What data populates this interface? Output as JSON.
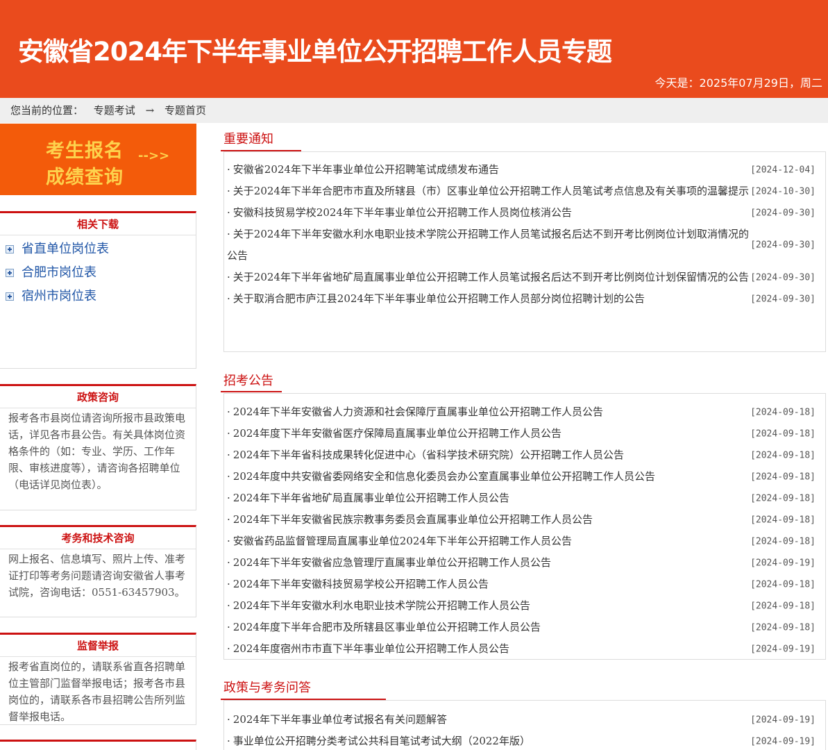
{
  "header": {
    "title": "安徽省2024年下半年事业单位公开招聘工作人员专题",
    "date_text": "今天是：2025年07月29日，周二"
  },
  "breadcrumb": {
    "label": "您当前的位置：",
    "items": [
      "专题考试",
      "→",
      "专题首页"
    ]
  },
  "signup_banner": {
    "line1": "考生报名",
    "line2": "成绩查询",
    "arrow": "-->>"
  },
  "downloads": {
    "title": "相关下载",
    "items": [
      {
        "label": "省直单位岗位表"
      },
      {
        "label": "合肥市岗位表"
      },
      {
        "label": "宿州市岗位表"
      }
    ]
  },
  "policy": {
    "title": "政策咨询",
    "text": "报考各市县岗位请咨询所报市县政策电话，详见各市县公告。有关具体岗位资格条件的（如：专业、学历、工作年限、审核进度等），请咨询各招聘单位（电话详见岗位表）。"
  },
  "tech": {
    "title": "考务和技术咨询",
    "text": "网上报名、信息填写、照片上传、准考证打印等考务问题请咨询安徽省人事考试院，咨询电话：0551-63457903。"
  },
  "report": {
    "title": "监督举报",
    "text": "报考省直岗位的，请联系省直各招聘单位主管部门监督举报电话；报考各市县岗位的，请联系各市县招聘公告所列监督举报电话。"
  },
  "notices": {
    "title": "重要通知",
    "items": [
      {
        "title": "安徽省2024年下半年事业单位公开招聘笔试成绩发布通告",
        "date": "[2024-12-04]"
      },
      {
        "title": "关于2024年下半年合肥市市直及所辖县（市）区事业单位公开招聘工作人员笔试考点信息及有关事项的温馨提示",
        "date": "[2024-10-30]"
      },
      {
        "title": "安徽科技贸易学校2024年下半年事业单位公开招聘工作人员岗位核消公告",
        "date": "[2024-09-30]"
      },
      {
        "title": "关于2024年下半年安徽水利水电职业技术学院公开招聘工作人员笔试报名后达不到开考比例岗位计划取消情况的公告",
        "date": "[2024-09-30]"
      },
      {
        "title": "关于2024年下半年省地矿局直属事业单位公开招聘工作人员笔试报名后达不到开考比例岗位计划保留情况的公告",
        "date": "[2024-09-30]"
      },
      {
        "title": "关于取消合肥市庐江县2024年下半年事业单位公开招聘工作人员部分岗位招聘计划的公告",
        "date": "[2024-09-30]"
      }
    ]
  },
  "announcements": {
    "title": "招考公告",
    "items": [
      {
        "title": "2024年下半年安徽省人力资源和社会保障厅直属事业单位公开招聘工作人员公告",
        "date": "[2024-09-18]"
      },
      {
        "title": "2024年度下半年安徽省医疗保障局直属事业单位公开招聘工作人员公告",
        "date": "[2024-09-18]"
      },
      {
        "title": "2024年下半年省科技成果转化促进中心（省科学技术研究院）公开招聘工作人员公告",
        "date": "[2024-09-18]"
      },
      {
        "title": "2024年度中共安徽省委网络安全和信息化委员会办公室直属事业单位公开招聘工作人员公告",
        "date": "[2024-09-18]"
      },
      {
        "title": "2024年下半年省地矿局直属事业单位公开招聘工作人员公告",
        "date": "[2024-09-18]"
      },
      {
        "title": "2024年下半年安徽省民族宗教事务委员会直属事业单位公开招聘工作人员公告",
        "date": "[2024-09-18]"
      },
      {
        "title": "安徽省药品监督管理局直属事业单位2024年下半年公开招聘工作人员公告",
        "date": "[2024-09-18]"
      },
      {
        "title": "2024年下半年安徽省应急管理厅直属事业单位公开招聘工作人员公告",
        "date": "[2024-09-19]"
      },
      {
        "title": "2024年下半年安徽科技贸易学校公开招聘工作人员公告",
        "date": "[2024-09-18]"
      },
      {
        "title": "2024年下半年安徽水利水电职业技术学院公开招聘工作人员公告",
        "date": "[2024-09-18]"
      },
      {
        "title": "2024年度下半年合肥市及所辖县区事业单位公开招聘工作人员公告",
        "date": "[2024-09-18]"
      },
      {
        "title": "2024年度宿州市市直下半年事业单位公开招聘工作人员公告",
        "date": "[2024-09-19]"
      }
    ]
  },
  "faq": {
    "title": "政策与考务问答",
    "items": [
      {
        "title": "2024年下半年事业单位考试报名有关问题解答",
        "date": "[2024-09-19]"
      },
      {
        "title": "事业单位公开招聘分类考试公共科目笔试考试大纲（2022年版）",
        "date": "[2024-09-19]"
      }
    ]
  }
}
